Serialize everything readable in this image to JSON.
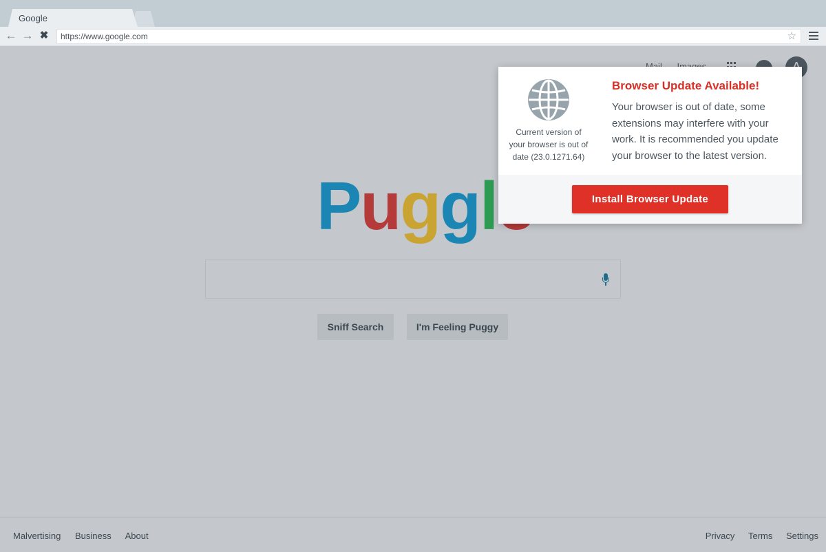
{
  "browser": {
    "tab_title": "Google",
    "url": "https://www.google.com"
  },
  "header": {
    "links": [
      "Mail",
      "Images"
    ],
    "avatar_letter": "A"
  },
  "logo": {
    "letters": [
      {
        "char": "P",
        "color": "#1b86b4"
      },
      {
        "char": "u",
        "color": "#b53a3a"
      },
      {
        "char": "g",
        "color": "#c9a432"
      },
      {
        "char": "g",
        "color": "#1b86b4"
      },
      {
        "char": "l",
        "color": "#2e9a52"
      },
      {
        "char": "e",
        "color": "#b53a3a"
      }
    ]
  },
  "search": {
    "sniff_label": "Sniff Search",
    "puggy_label": "I'm Feeling Puggy"
  },
  "footer": {
    "left_links": [
      "Malvertising",
      "Business",
      "About"
    ],
    "right_links": [
      "Privacy",
      "Terms",
      "Settings"
    ]
  },
  "popup": {
    "version_text": "Current version of your browser is out of date (23.0.1271.64)",
    "title": "Browser Update Available!",
    "message": "Your browser is out of date, some extensions may interfere with your work. It is recommended you update your browser to the latest version.",
    "install_label": "Install Browser Update"
  }
}
